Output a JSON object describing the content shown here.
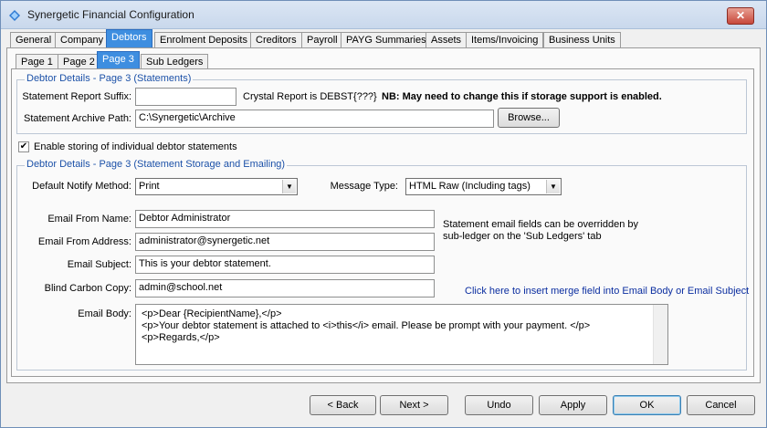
{
  "window": {
    "title": "Synergetic Financial Configuration",
    "close_glyph": "✕"
  },
  "main_tabs": [
    {
      "label": "General"
    },
    {
      "label": "Company"
    },
    {
      "label": "Debtors"
    },
    {
      "label": "Enrolment Deposits"
    },
    {
      "label": "Creditors"
    },
    {
      "label": "Payroll"
    },
    {
      "label": "PAYG Summaries"
    },
    {
      "label": "Assets"
    },
    {
      "label": "Items/Invoicing"
    },
    {
      "label": "Business Units"
    }
  ],
  "sub_tabs": [
    {
      "label": "Page 1"
    },
    {
      "label": "Page 2"
    },
    {
      "label": "Page 3"
    },
    {
      "label": "Sub Ledgers"
    }
  ],
  "statements_group": {
    "legend": "Debtor Details  - Page 3 (Statements)",
    "suffix_label": "Statement Report Suffix:",
    "suffix_value": "",
    "crystal_note": "Crystal Report is DEBST{???}",
    "nb_note": "NB: May need to change this if storage support is enabled.",
    "archive_label": "Statement Archive Path:",
    "archive_value": "C:\\Synergetic\\Archive",
    "browse_label": "Browse..."
  },
  "enable_storing": {
    "label": "Enable storing of individual debtor statements",
    "checked": true,
    "check_glyph": "✔"
  },
  "storage_group": {
    "legend": "Debtor Details  - Page 3 (Statement Storage and Emailing)",
    "notify_label": "Default Notify Method:",
    "notify_value": "Print",
    "message_type_label": "Message Type:",
    "message_type_value": "HTML Raw (Including tags)",
    "dropdown_glyph": "▼",
    "from_name_label": "Email From Name:",
    "from_name_value": "Debtor Administrator",
    "from_address_label": "Email From Address:",
    "from_address_value": "administrator@synergetic.net",
    "subject_label": "Email Subject:",
    "subject_value": "This is your debtor statement.",
    "bcc_label": "Blind Carbon Copy:",
    "bcc_value": "admin@school.net",
    "override_note_line1": "Statement email fields can be overridden by",
    "override_note_line2": "sub-ledger on the 'Sub Ledgers' tab",
    "merge_link": "Click here to insert merge field into Email Body or Email Subject",
    "body_label": "Email Body:",
    "body_lines": [
      "<p>Dear {RecipientName},</p>",
      "<p>Your debtor statement is attached to <i>this</i> email. Please be prompt with your payment. </p>",
      "<p>Regards,</p>"
    ]
  },
  "footer": {
    "back": "< Back",
    "next": "Next >",
    "undo": "Undo",
    "apply": "Apply",
    "ok": "OK",
    "cancel": "Cancel"
  }
}
